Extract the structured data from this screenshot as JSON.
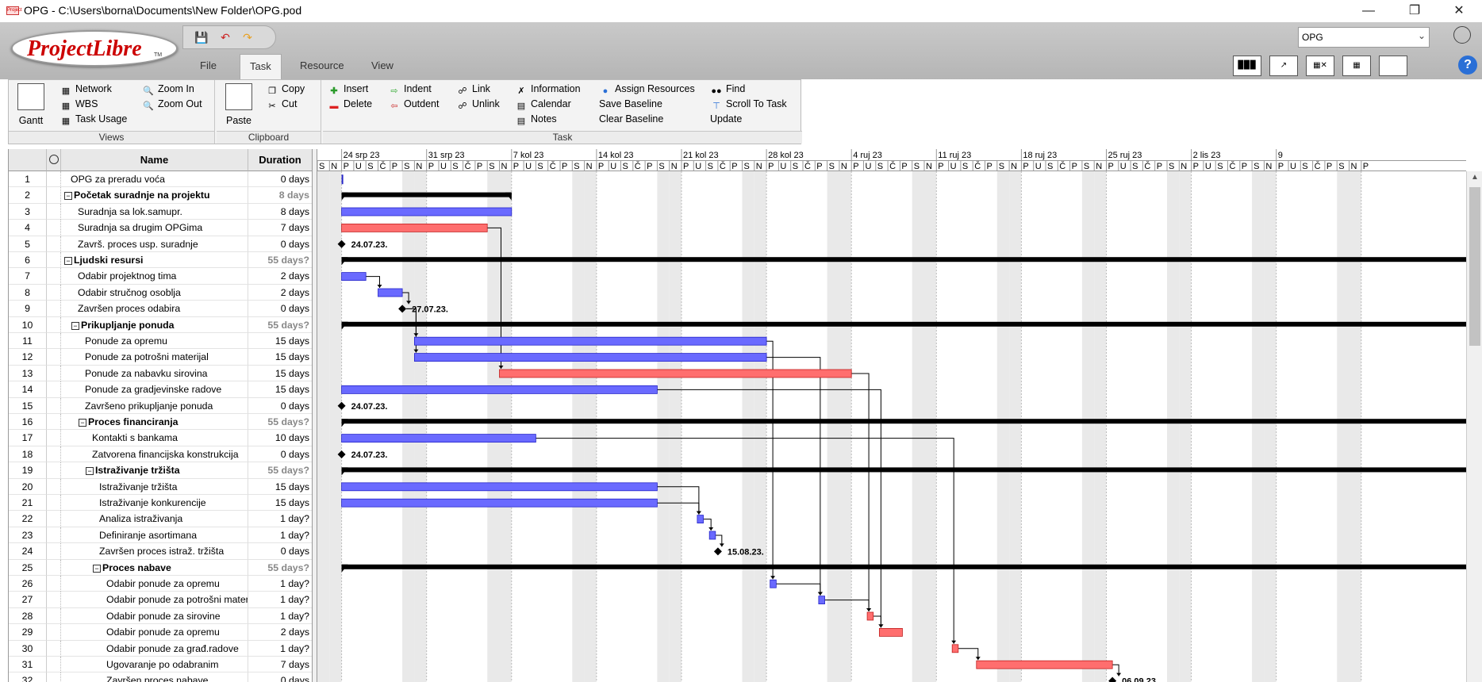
{
  "window": {
    "title": "OPG - C:\\Users\\borna\\Documents\\New Folder\\OPG.pod",
    "app_icon_text": "Project"
  },
  "app": {
    "logo_text": "ProjectLibre",
    "logo_tm": "TM",
    "project_selector": "OPG"
  },
  "menu_tabs": [
    "File",
    "Task",
    "Resource",
    "View"
  ],
  "active_tab": "Task",
  "ribbon": {
    "views": {
      "title": "Views",
      "gantt": "Gantt",
      "network": "Network",
      "wbs": "WBS",
      "task_usage": "Task Usage",
      "zoom_in": "Zoom In",
      "zoom_out": "Zoom Out"
    },
    "clipboard": {
      "title": "Clipboard",
      "paste": "Paste",
      "copy": "Copy",
      "cut": "Cut"
    },
    "task": {
      "title": "Task",
      "insert": "Insert",
      "delete": "Delete",
      "indent": "Indent",
      "outdent": "Outdent",
      "link": "Link",
      "unlink": "Unlink",
      "information": "Information",
      "calendar": "Calendar",
      "notes": "Notes",
      "assign_resources": "Assign Resources",
      "save_baseline": "Save Baseline",
      "clear_baseline": "Clear Baseline",
      "find": "Find",
      "scroll_to_task": "Scroll To Task",
      "update": "Update"
    }
  },
  "table": {
    "columns": {
      "name": "Name",
      "duration": "Duration"
    },
    "rows": [
      {
        "id": "1",
        "name": "OPG za preradu voća",
        "duration": "0 days",
        "level": 0,
        "summary": false
      },
      {
        "id": "2",
        "name": "Početak suradnje na projektu",
        "duration": "8 days",
        "level": 0,
        "summary": true
      },
      {
        "id": "3",
        "name": "Suradnja sa lok.samupr.",
        "duration": "8 days",
        "level": 1,
        "summary": false
      },
      {
        "id": "4",
        "name": "Suradnja sa drugim OPGima",
        "duration": "7 days",
        "level": 1,
        "summary": false
      },
      {
        "id": "5",
        "name": "Završ. proces usp. suradnje",
        "duration": "0 days",
        "level": 1,
        "summary": false
      },
      {
        "id": "6",
        "name": "Ljudski resursi",
        "duration": "55 days?",
        "level": 0,
        "summary": true
      },
      {
        "id": "7",
        "name": "Odabir projektnog tima",
        "duration": "2 days",
        "level": 1,
        "summary": false
      },
      {
        "id": "8",
        "name": "Odabir stručnog osoblja",
        "duration": "2 days",
        "level": 1,
        "summary": false
      },
      {
        "id": "9",
        "name": "Završen proces odabira",
        "duration": "0 days",
        "level": 1,
        "summary": false
      },
      {
        "id": "10",
        "name": "Prikupljanje ponuda",
        "duration": "55 days?",
        "level": 1,
        "summary": true
      },
      {
        "id": "11",
        "name": "Ponude za opremu",
        "duration": "15 days",
        "level": 2,
        "summary": false
      },
      {
        "id": "12",
        "name": "Ponude za potrošni materijal",
        "duration": "15 days",
        "level": 2,
        "summary": false
      },
      {
        "id": "13",
        "name": "Ponude za nabavku sirovina",
        "duration": "15 days",
        "level": 2,
        "summary": false
      },
      {
        "id": "14",
        "name": "Ponude za gradjevinske radove",
        "duration": "15 days",
        "level": 2,
        "summary": false
      },
      {
        "id": "15",
        "name": "Završeno prikupljanje ponuda",
        "duration": "0 days",
        "level": 2,
        "summary": false
      },
      {
        "id": "16",
        "name": "Proces financiranja",
        "duration": "55 days?",
        "level": 2,
        "summary": true
      },
      {
        "id": "17",
        "name": "Kontakti s bankama",
        "duration": "10 days",
        "level": 3,
        "summary": false
      },
      {
        "id": "18",
        "name": "Zatvorena financijska konstrukcija",
        "duration": "0 days",
        "level": 3,
        "summary": false
      },
      {
        "id": "19",
        "name": "Istraživanje tržišta",
        "duration": "55 days?",
        "level": 3,
        "summary": true
      },
      {
        "id": "20",
        "name": "Istraživanje tržišta",
        "duration": "15 days",
        "level": 4,
        "summary": false
      },
      {
        "id": "21",
        "name": "Istraživanje konkurencije",
        "duration": "15 days",
        "level": 4,
        "summary": false
      },
      {
        "id": "22",
        "name": "Analiza istraživanja",
        "duration": "1 day?",
        "level": 4,
        "summary": false
      },
      {
        "id": "23",
        "name": "Definiranje asortimana",
        "duration": "1 day?",
        "level": 4,
        "summary": false
      },
      {
        "id": "24",
        "name": "Završen proces istraž. tržišta",
        "duration": "0 days",
        "level": 4,
        "summary": false
      },
      {
        "id": "25",
        "name": "Proces nabave",
        "duration": "55 days?",
        "level": 4,
        "summary": true
      },
      {
        "id": "26",
        "name": "Odabir ponude za opremu",
        "duration": "1 day?",
        "level": 5,
        "summary": false
      },
      {
        "id": "27",
        "name": "Odabir ponude za potrošni materijal",
        "duration": "1 day?",
        "level": 5,
        "summary": false
      },
      {
        "id": "28",
        "name": "Odabir ponude za sirovine",
        "duration": "1 day?",
        "level": 5,
        "summary": false
      },
      {
        "id": "29",
        "name": "Odabir ponude za opremu",
        "duration": "2 days",
        "level": 5,
        "summary": false
      },
      {
        "id": "30",
        "name": "Odabir ponude za građ.radove",
        "duration": "1 day?",
        "level": 5,
        "summary": false
      },
      {
        "id": "31",
        "name": "Ugovaranje po odabranim",
        "duration": "7 days",
        "level": 5,
        "summary": false
      },
      {
        "id": "32",
        "name": "Završen proces nabave",
        "duration": "0 days",
        "level": 5,
        "summary": false
      }
    ]
  },
  "gantt": {
    "weeks": [
      "24 srp 23",
      "31 srp 23",
      "7 kol 23",
      "14 kol 23",
      "21 kol 23",
      "28 kol 23",
      "4 ruj 23",
      "11 ruj 23",
      "18 ruj 23",
      "25 ruj 23",
      "2 lis 23",
      "9"
    ],
    "day_letters": [
      "S",
      "N",
      "P",
      "U",
      "S",
      "Č",
      "P",
      "S",
      "N",
      "P",
      "U",
      "S",
      "Č",
      "P",
      "S",
      "N",
      "P",
      "U",
      "S",
      "Č",
      "P",
      "S",
      "N",
      "P",
      "U",
      "S",
      "Č",
      "P",
      "S",
      "N",
      "P",
      "U",
      "S",
      "Č",
      "P",
      "S",
      "N",
      "P",
      "U",
      "S",
      "Č",
      "P",
      "S",
      "N",
      "P",
      "U",
      "S",
      "Č",
      "P",
      "S",
      "N",
      "P",
      "U",
      "S",
      "Č",
      "P",
      "S",
      "N",
      "P",
      "U",
      "S",
      "Č",
      "P",
      "S",
      "N",
      "P",
      "U",
      "S",
      "Č",
      "P",
      "S",
      "N",
      "P",
      "U",
      "S",
      "Č",
      "P",
      "S",
      "N",
      "P",
      "U",
      "S",
      "Č",
      "P",
      "S",
      "N",
      "P"
    ],
    "first_day_label": "S",
    "colors": {
      "task": "#6a6aff",
      "critical": "#ff6e6e",
      "summary": "#000000",
      "weekend": "#e9e9e9"
    },
    "bars": [
      {
        "row": 1,
        "type": "start_marker",
        "start": 2,
        "end": 2
      },
      {
        "row": 2,
        "type": "summary",
        "start": 2,
        "end": 16
      },
      {
        "row": 3,
        "type": "task",
        "start": 2,
        "end": 16
      },
      {
        "row": 4,
        "type": "critical",
        "start": 2,
        "end": 14
      },
      {
        "row": 5,
        "type": "milestone",
        "start": 2,
        "label": "24.07.23."
      },
      {
        "row": 6,
        "type": "summary",
        "start": 2,
        "end": 107
      },
      {
        "row": 7,
        "type": "task",
        "start": 2,
        "end": 4
      },
      {
        "row": 8,
        "type": "task",
        "start": 5,
        "end": 7
      },
      {
        "row": 9,
        "type": "milestone",
        "start": 7,
        "label": "27.07.23."
      },
      {
        "row": 10,
        "type": "summary",
        "start": 2,
        "end": 107
      },
      {
        "row": 11,
        "type": "task",
        "start": 8,
        "end": 37
      },
      {
        "row": 12,
        "type": "task",
        "start": 8,
        "end": 37
      },
      {
        "row": 13,
        "type": "critical",
        "start": 15,
        "end": 44
      },
      {
        "row": 14,
        "type": "task",
        "start": 2,
        "end": 28
      },
      {
        "row": 15,
        "type": "milestone",
        "start": 2,
        "label": "24.07.23."
      },
      {
        "row": 16,
        "type": "summary",
        "start": 2,
        "end": 107
      },
      {
        "row": 17,
        "type": "task",
        "start": 2,
        "end": 18
      },
      {
        "row": 18,
        "type": "milestone",
        "start": 2,
        "label": "24.07.23."
      },
      {
        "row": 19,
        "type": "summary",
        "start": 2,
        "end": 107
      },
      {
        "row": 20,
        "type": "task",
        "start": 2,
        "end": 28
      },
      {
        "row": 21,
        "type": "task",
        "start": 2,
        "end": 28
      },
      {
        "row": 22,
        "type": "task",
        "start": 31.3,
        "end": 31.8
      },
      {
        "row": 23,
        "type": "task",
        "start": 32.3,
        "end": 32.8
      },
      {
        "row": 24,
        "type": "milestone",
        "start": 33,
        "label": "15.08.23."
      },
      {
        "row": 25,
        "type": "summary",
        "start": 2,
        "end": 107
      },
      {
        "row": 26,
        "type": "task",
        "start": 37.3,
        "end": 37.8
      },
      {
        "row": 27,
        "type": "task",
        "start": 41.3,
        "end": 41.8
      },
      {
        "row": 28,
        "type": "critical",
        "start": 45.3,
        "end": 45.8
      },
      {
        "row": 29,
        "type": "critical",
        "start": 46.3,
        "end": 48.2
      },
      {
        "row": 30,
        "type": "critical",
        "start": 52.3,
        "end": 52.8
      },
      {
        "row": 31,
        "type": "critical",
        "start": 54.3,
        "end": 65.5
      },
      {
        "row": 32,
        "type": "milestone",
        "start": 65.5,
        "label": "06.09.23."
      }
    ],
    "links": [
      {
        "from": 4,
        "to": 13
      },
      {
        "from": 7,
        "to": 8
      },
      {
        "from": 8,
        "to": 9
      },
      {
        "from": 9,
        "to": 11
      },
      {
        "from": 9,
        "to": 12
      },
      {
        "from": 11,
        "to": 26
      },
      {
        "from": 12,
        "to": 27
      },
      {
        "from": 13,
        "to": 28
      },
      {
        "from": 14,
        "to": 29
      },
      {
        "from": 17,
        "to": 30
      },
      {
        "from": 20,
        "to": 22
      },
      {
        "from": 21,
        "to": 22
      },
      {
        "from": 22,
        "to": 23
      },
      {
        "from": 23,
        "to": 24
      },
      {
        "from": 26,
        "to": 27
      },
      {
        "from": 27,
        "to": 28
      },
      {
        "from": 28,
        "to": 29
      },
      {
        "from": 30,
        "to": 31
      },
      {
        "from": 31,
        "to": 32
      }
    ]
  }
}
